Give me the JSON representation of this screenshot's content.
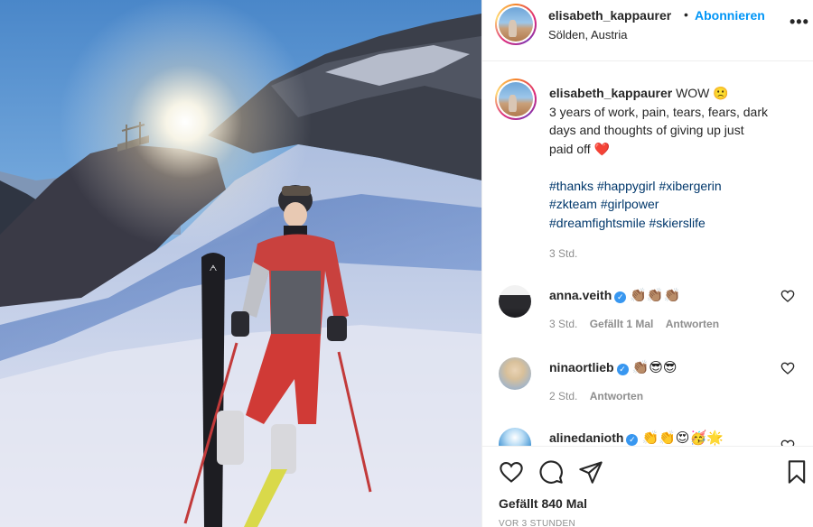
{
  "post": {
    "username": "elisabeth_kappaurer",
    "dot": "•",
    "follow_label": "Abonnieren",
    "location": "Sölden, Austria",
    "more_label": "•••"
  },
  "caption": {
    "username": "elisabeth_kappaurer",
    "lines": [
      "WOW 🙁",
      "3 years of work, pain, tears, fears, dark",
      "days and thoughts of giving up just",
      "paid off ❤️"
    ],
    "hashtags": [
      "#thanks",
      "#happygirl",
      "#xibergerin",
      "#zkteam",
      "#girlpower",
      "#dreamfightsmile",
      "#skierslife"
    ],
    "time": "3 Std."
  },
  "comments": [
    {
      "username": "anna.veith",
      "verified": true,
      "text": "👏🏽👏🏽👏🏽",
      "time": "3 Std.",
      "likes": "Gefällt 1 Mal",
      "reply": "Antworten"
    },
    {
      "username": "ninaortlieb",
      "verified": true,
      "text": "👏🏽😎😎",
      "time": "2 Std.",
      "reply": "Antworten"
    },
    {
      "username": "alinedanioth",
      "verified": true,
      "text": "👏👏😍🥳🌟"
    }
  ],
  "verified_mark": "✓",
  "footer": {
    "likes": "Gefällt 840 Mal",
    "time": "VOR 3 STUNDEN"
  },
  "colors": {
    "accent": "#0095f6",
    "hashtag": "#00376b",
    "muted": "#8e8e8e",
    "verified": "#3897f0",
    "heart": "#ed4956"
  },
  "icons": {
    "more": "more-options-icon",
    "heart": "heart-icon",
    "comment": "comment-icon",
    "share": "share-icon",
    "save": "bookmark-icon",
    "verified": "verified-badge-icon"
  }
}
